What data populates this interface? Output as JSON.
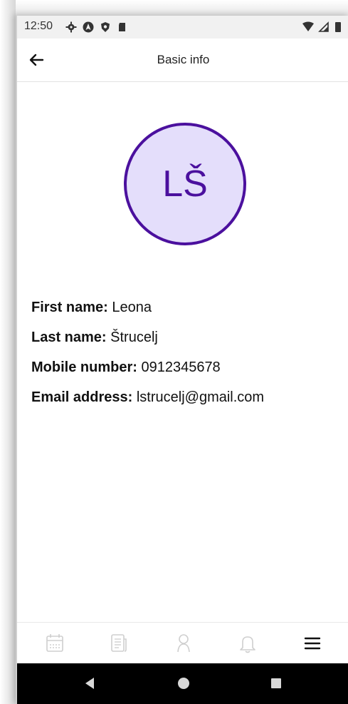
{
  "status_bar": {
    "time": "12:50",
    "icons": [
      "gear-icon",
      "navigation-icon",
      "shield-icon",
      "sd-card-icon"
    ],
    "right_icons": [
      "wifi-icon",
      "cell-signal-icon",
      "battery-icon"
    ]
  },
  "app_bar": {
    "title": "Basic info",
    "back_icon": "arrow-left-icon"
  },
  "profile": {
    "initials": "LŠ",
    "avatar_bg": "#e4defb",
    "avatar_border": "#4b109e",
    "fields": [
      {
        "label": "First name:",
        "value": "Leona"
      },
      {
        "label": "Last name:",
        "value": "Štrucelj"
      },
      {
        "label": "Mobile number:",
        "value": "0912345678"
      },
      {
        "label": "Email address:",
        "value": "lstrucelj@gmail.com"
      }
    ]
  },
  "bottom_nav": {
    "items": [
      "calendar-icon",
      "news-icon",
      "profile-icon",
      "bell-icon",
      "menu-icon"
    ],
    "active": "menu-icon"
  },
  "system_nav": {
    "buttons": [
      "back-triangle-icon",
      "home-circle-icon",
      "recents-square-icon"
    ]
  }
}
